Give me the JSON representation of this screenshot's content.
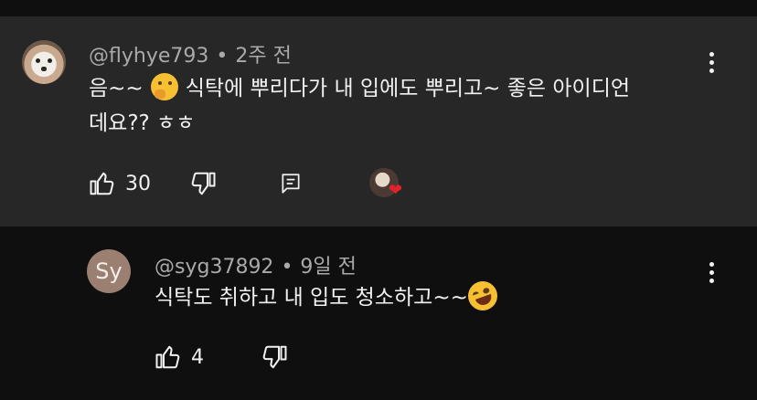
{
  "comment": {
    "author": "@flyhye793",
    "dot": "•",
    "time": "2주 전",
    "text_a": "음~~",
    "text_b": "식탁에 뿌리다가 내 입에도 뿌리고~ 좋은 아이디언",
    "text_c": "데요?? ㅎㅎ",
    "likes": "30",
    "emoji_icon": "thinking-face-icon",
    "creator_heart_icon": "heart-icon"
  },
  "reply": {
    "avatar_initials": "Sy",
    "author": "@syg37892",
    "dot": "•",
    "time": "9일 전",
    "text": "식탁도 취하고 내 입도 청소하고~~",
    "emoji_icon": "rolling-laughing-face-icon",
    "likes": "4"
  },
  "colors": {
    "background": "#0f0f0f",
    "card": "#272727",
    "primary_text": "#f1f1f1",
    "secondary_text": "#aaaaaa",
    "heart": "#e3212b"
  }
}
